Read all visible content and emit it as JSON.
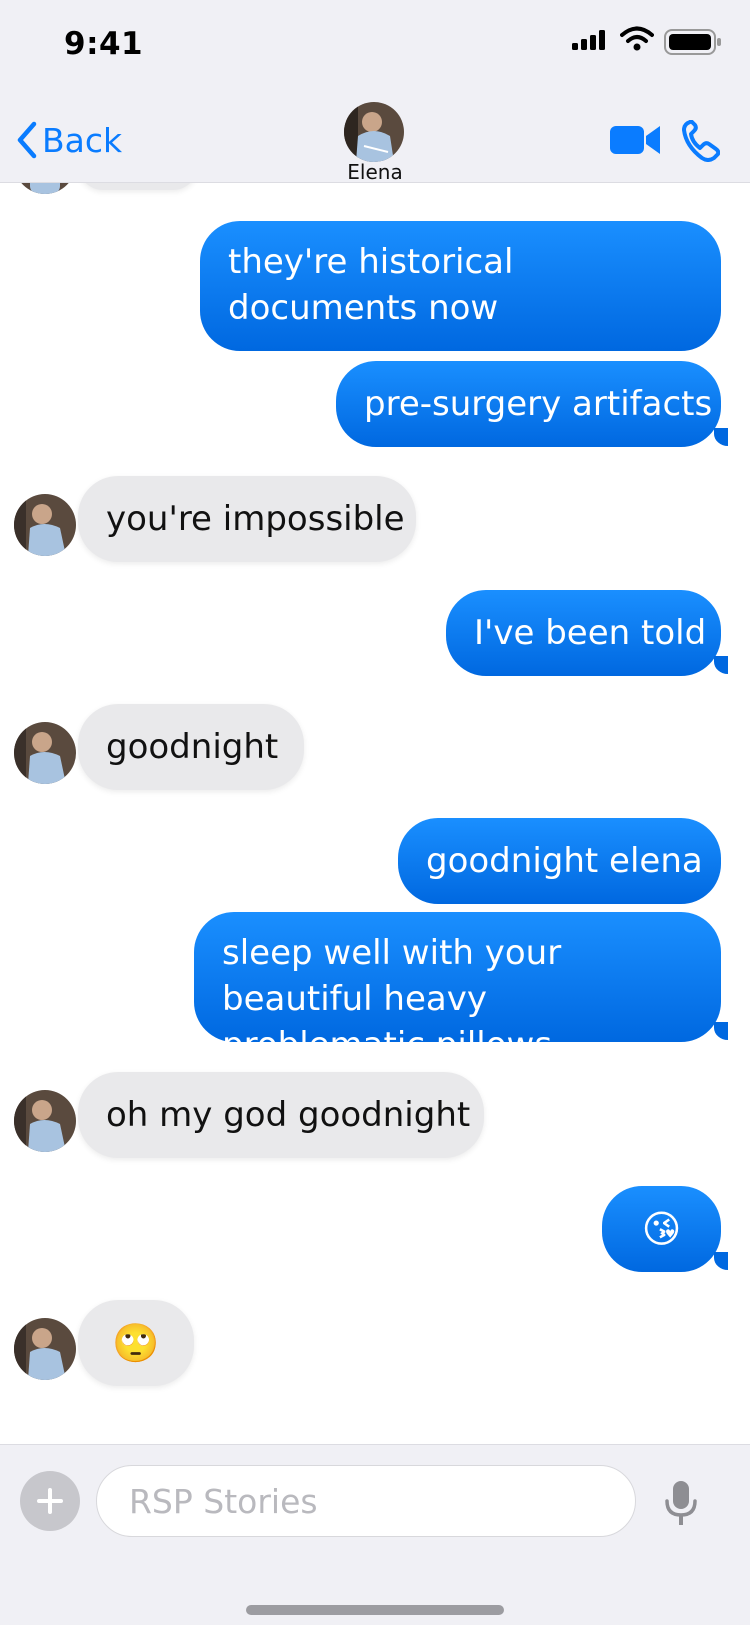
{
  "status_bar": {
    "time": "9:41"
  },
  "nav": {
    "back_label": "Back",
    "contact_name": "Elena",
    "video_icon": "video-call-icon",
    "phone_icon": "phone-call-icon"
  },
  "messages": [
    {
      "from": "me",
      "text": "they're historical documents now"
    },
    {
      "from": "me",
      "text": "pre-surgery artifacts"
    },
    {
      "from": "them",
      "text": "you're impossible"
    },
    {
      "from": "me",
      "text": "I've been told"
    },
    {
      "from": "them",
      "text": "goodnight"
    },
    {
      "from": "me",
      "text": "goodnight elena"
    },
    {
      "from": "me",
      "text": "sleep well with your beautiful heavy problematic pillows"
    },
    {
      "from": "them",
      "text": "oh my god goodnight"
    },
    {
      "from": "me",
      "text": "😘"
    },
    {
      "from": "them",
      "text": "🙄"
    }
  ],
  "composer": {
    "placeholder": "RSP Stories",
    "plus_icon": "plus-icon",
    "mic_icon": "microphone-icon"
  },
  "colors": {
    "accent": "#0a7cff",
    "outgoing_bubble": "#0a74f0",
    "incoming_bubble": "#e9e9eb"
  }
}
